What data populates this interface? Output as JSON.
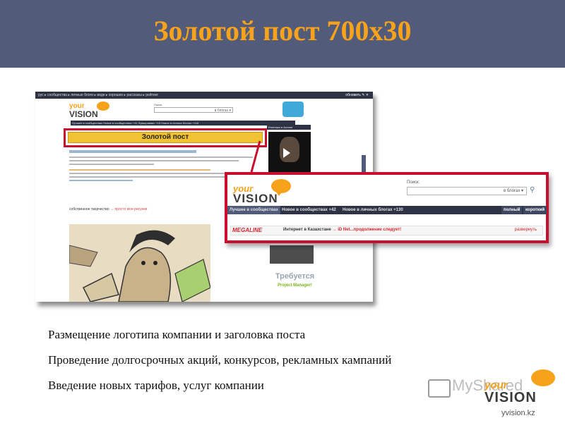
{
  "slide": {
    "title": "Золотой пост 700х30",
    "bullets": [
      "Размещение логотипа компании и заголовка поста",
      "Проведение долгосрочных акций, конкурсов, рекламных кампаний",
      "Введение новых тарифов, услуг компании"
    ]
  },
  "screenshot": {
    "topbar_text": "рус ▸  сообщества ▸  личные блоги ▸  виде ▸  хорошее ▸  рассказы ▸  рейтинг",
    "topbar_right": "обновить ✎ ✕",
    "search_label": "Поиск:",
    "search_scope": "в блогах ▾",
    "tabbar_text": "Лучшее в сообществах   Новое в сообществах +41   Фрашраммы +15   Новое в личных блогах +118",
    "golden_post_label": "Золотой пост",
    "right_col_head": "Евгенька в Астане",
    "section_head": "собственное творчество",
    "section_link": "просто мои рисунки",
    "requirement_title": "Требуется",
    "requirement_sub": "Project Manager!",
    "colors": {
      "accent": "#f7a21b",
      "callout_border": "#c8102e",
      "golden_bar": "#f1c232",
      "nav": "#2d3345"
    }
  },
  "callout": {
    "logo_your": "your",
    "logo_vision": "VISION",
    "search_label": "Поиск:",
    "search_scope": "в блогах ▾",
    "tabs": [
      {
        "label": "Лучшее в сообществах"
      },
      {
        "label": "Новое в сообществах +42"
      },
      {
        "label": "Новое в личных блогах +130"
      }
    ],
    "tab_right_1": "полный",
    "tab_right_2": "короткий",
    "ad_brand": "MEGALINE",
    "ad_text": "Интернет в Казахстане",
    "ad_arrow": " → ",
    "ad_highlight": "iD Net...продолжение следует!",
    "ad_expand": "развернуть"
  },
  "watermark": {
    "myshared": "MyShared",
    "logo_your": "your",
    "logo_vision": "VISION",
    "domain": "yvision.kz"
  }
}
